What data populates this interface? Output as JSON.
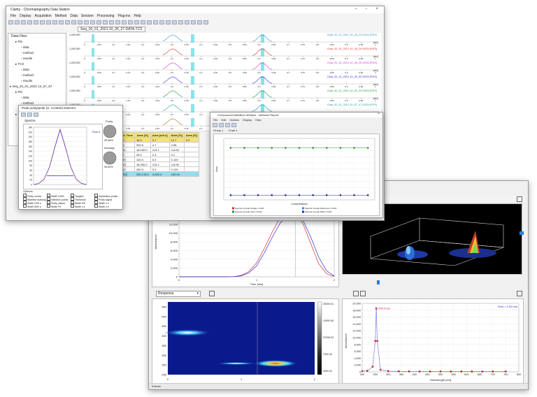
{
  "main_window": {
    "title": "Clarity - Chromatography Data Station",
    "menu": [
      "File",
      "Display",
      "Acquisition",
      "Method",
      "Data",
      "Session",
      "Processing",
      "Plug-ins",
      "Help"
    ],
    "toolbar2_path": "Seq_20_01_2021 10_26_27 DATA.TCS",
    "tree_title": "Data Files",
    "tree": [
      {
        "label": "RG",
        "indent": 1
      },
      {
        "label": "data",
        "indent": 2
      },
      {
        "label": "method",
        "indent": 2
      },
      {
        "label": "results",
        "indent": 2
      },
      {
        "label": "TCS",
        "indent": 1
      },
      {
        "label": "data",
        "indent": 2
      },
      {
        "label": "method",
        "indent": 2
      },
      {
        "label": "results",
        "indent": 2
      },
      {
        "label": "Seq_20_01_2021 14_57_67",
        "indent": 0
      },
      {
        "label": "RG",
        "indent": 1
      },
      {
        "label": "data",
        "indent": 2
      },
      {
        "label": "method",
        "indent": 2
      },
      {
        "label": "results",
        "indent": 2
      },
      {
        "label": "TCS",
        "indent": 1
      },
      {
        "label": "data",
        "indent": 2
      },
      {
        "label": "method",
        "indent": 2
      }
    ],
    "tracks": [
      {
        "label": "Dual_20_01_2021 10_26_29 DATA (PDS)",
        "color": "#2b8fd6"
      },
      {
        "label": "Dual_20_01_2021 10_26_29 DATA (PDS)",
        "color": "#d62b2b"
      },
      {
        "label": "Dual_20_01_2021 10_48_20 DATA (PDS)",
        "color": "#d62bd6"
      },
      {
        "label": "Dual_20_01_2021 10_49_53 DATA (PDS)",
        "color": "#2b2bd6"
      },
      {
        "label": "Dual_20_01_2021 10_53_20 DATA (PDS)",
        "color": "#1a9a3a"
      },
      {
        "label": "Dual_20_01_2021 10_57_47 DATA (PDS)",
        "color": "#1a9aa0"
      },
      {
        "label": "Dual_20_01_2021 11_02_13 DATA (PDS)",
        "color": "#a06a1a"
      }
    ],
    "track_ticks": [
      "0",
      "0.05",
      "0.1",
      "0.15",
      "0.2",
      "0.25",
      "0.3",
      "0.35",
      "0.4",
      "0.45",
      "0.5",
      "0.55",
      "0.6",
      "0.65",
      "0.7",
      "0.75",
      "0.8",
      "0.85",
      "0.9",
      "0.95",
      "1"
    ],
    "track_unit": "[mV]",
    "track_ymax": "1,000,000",
    "results_table": {
      "headers": [
        "Ret. Time",
        "Area [%]",
        "Area [mV.s]",
        "Area [%]",
        "Area [%]"
      ],
      "rows": [
        [
          "0.0",
          "18.0",
          "0.7",
          "12.7",
          "0.0"
        ],
        [
          "0.5",
          "250.5",
          "4.7",
          "4.08",
          ""
        ],
        [
          "0.11",
          "18,030.0",
          "213.1",
          "4.8.08",
          ""
        ],
        [
          "0.2",
          "25.0",
          "0.3",
          "0.2",
          ""
        ],
        [
          "0.75",
          "100.0",
          "6.3",
          "0.149",
          ""
        ],
        [
          "0.53",
          "18,030.0",
          "213.1",
          "4.8.08",
          ""
        ],
        [
          "0.12",
          "250.5",
          "5.3",
          "0.125",
          ""
        ]
      ],
      "total": [
        "100.0",
        "200,178.0",
        "4,026.4",
        "100.00",
        ""
      ]
    }
  },
  "purity_window": {
    "title": "Peak purity/peak (S. Content) Detector",
    "plot_title": "Spectra",
    "legend": "Peak A",
    "pie1_label": "Purity",
    "pie1_value": "99.86%",
    "pie2_label": "Average",
    "pie2_value": "99.80%",
    "options_title": "Options",
    "options": [
      "Purity curves",
      "Baseline drawing",
      "Width 10% s",
      "Width 50% s",
      "Width 100%",
      "Inflection points",
      "Purity values",
      "Width FS",
      "Tangent",
      "Threshold",
      "Width 5%",
      "Width 4 s",
      "Separation points",
      "Purity signal",
      "Width 2 s",
      "Width 3 s"
    ]
  },
  "graph_window": {
    "title": "Compound/Calibration Window - Variance Report",
    "menu": [
      "File",
      "Edit",
      "Options",
      "Display",
      "Help"
    ],
    "tabs": [
      "Group 1",
      "Chart 1"
    ],
    "y_label": "Area",
    "x_label": "Concentrations",
    "legend": [
      "Spectra of peak Voltage 1 DAD",
      "Spectra of peak Reference 1 DAD",
      "Spectra of peak Unkn 1 DAD",
      "Spectra of peak Ratio 2 DAD"
    ]
  },
  "pda_window": {
    "top_left_title": "Chromatogram",
    "top_left_legend": [
      {
        "text": "WL = 230.00 nm",
        "color": "#d62b2b"
      },
      {
        "text": "WL = 254.00 nm",
        "color": "#2b2bd6"
      }
    ],
    "top_right_title": "3D View",
    "bottom_left_select": "Response",
    "bottom_left_colorbar": [
      "25000.01",
      "13000.65",
      "37008.03",
      "7000.49",
      "3000.02"
    ],
    "bottom_right_label": "Time = 1.50 min",
    "bottom_right_marker": "254.0 nm",
    "bottom_right_xlabel": "Wavelength [nm]",
    "bottom_right_ylabel": "Absorbance",
    "status": "5 items"
  },
  "chart_data": [
    {
      "type": "line",
      "title": "",
      "xlabel": "Time [min]",
      "ylabel": "Absorbance",
      "x": [
        0,
        0.1,
        0.2,
        0.3,
        0.4,
        0.5,
        0.6,
        0.7,
        0.8,
        0.9,
        1,
        1.1,
        1.2,
        1.3,
        1.4,
        1.5,
        1.6,
        1.7,
        1.8,
        1.9,
        2
      ],
      "series": [
        {
          "name": "WL = 230.00 nm",
          "values": [
            0,
            0,
            0,
            0,
            0,
            0,
            0,
            50,
            300,
            1200,
            3200,
            6500,
            10200,
            13500,
            15000,
            14800,
            12000,
            7500,
            3000,
            700,
            100
          ]
        },
        {
          "name": "WL = 254.00 nm",
          "values": [
            0,
            0,
            0,
            0,
            0,
            0,
            0,
            30,
            200,
            900,
            2500,
            5500,
            9000,
            12200,
            14200,
            14600,
            12800,
            9000,
            4500,
            1400,
            200
          ]
        }
      ],
      "ylim": [
        0,
        16000
      ],
      "yticks": [
        "0",
        "2,000",
        "4,000",
        "6,000",
        "8,000",
        "10,000",
        "12,000",
        "14,000",
        "16,000"
      ]
    },
    {
      "type": "line",
      "title": "",
      "xlabel": "Wavelength [nm]",
      "ylabel": "Absorbance",
      "x": [
        200,
        220,
        240,
        250,
        254,
        258,
        270,
        300,
        340,
        380,
        420,
        460,
        500,
        540,
        580,
        620,
        660,
        700,
        750
      ],
      "series": [
        {
          "name": "254.0 nm",
          "values": [
            200,
            300,
            1500,
            9000,
            18500,
            9000,
            600,
            200,
            150,
            120,
            110,
            100,
            100,
            100,
            100,
            100,
            100,
            100,
            100
          ]
        }
      ],
      "ylim": [
        0,
        20000
      ],
      "yticks": [
        "0",
        "2,000",
        "4,000",
        "6,000",
        "8,000",
        "10,000",
        "12,000",
        "14,000",
        "16,000",
        "18,000",
        "20,000"
      ],
      "xticks": [
        "200",
        "250",
        "300",
        "350",
        "400",
        "450",
        "500",
        "550",
        "600",
        "650",
        "700",
        "750",
        "800"
      ]
    },
    {
      "type": "scatter",
      "title": "",
      "xlabel": "Concentrations",
      "ylabel": "Area",
      "x": [
        1,
        2,
        3,
        4,
        5,
        6,
        7,
        8,
        9,
        10,
        11
      ],
      "series": [
        {
          "name": "Spectra of peak Voltage 1 DAD",
          "values": [
            100,
            100,
            100,
            100,
            100,
            100,
            100,
            100,
            100,
            100,
            100
          ]
        },
        {
          "name": "Spectra of peak Unkn 1 DAD",
          "values": [
            0,
            0,
            0,
            0,
            0,
            0,
            0,
            0,
            0,
            0,
            0
          ]
        }
      ],
      "ylim": [
        -10,
        120
      ]
    },
    {
      "type": "line",
      "title": "",
      "xlabel": "",
      "ylabel": "",
      "x": [
        0,
        1,
        2,
        3,
        4,
        5,
        6,
        7,
        8,
        9,
        10
      ],
      "series": [
        {
          "name": "Peak A",
          "values": [
            0,
            5,
            25,
            80,
            170,
            250,
            170,
            80,
            25,
            5,
            0
          ]
        }
      ],
      "ylim": [
        0,
        260
      ],
      "yticks": [
        "0",
        "20",
        "40",
        "60",
        "80",
        "100",
        "120",
        "140",
        "160",
        "180",
        "200",
        "220",
        "240"
      ]
    },
    {
      "type": "heatmap",
      "title": "",
      "xlabel": "",
      "ylabel": "",
      "yticks": [
        "200",
        "250",
        "300",
        "350",
        "400",
        "450",
        "500",
        "550"
      ],
      "xticks": [
        "0",
        "1",
        "2"
      ]
    }
  ]
}
